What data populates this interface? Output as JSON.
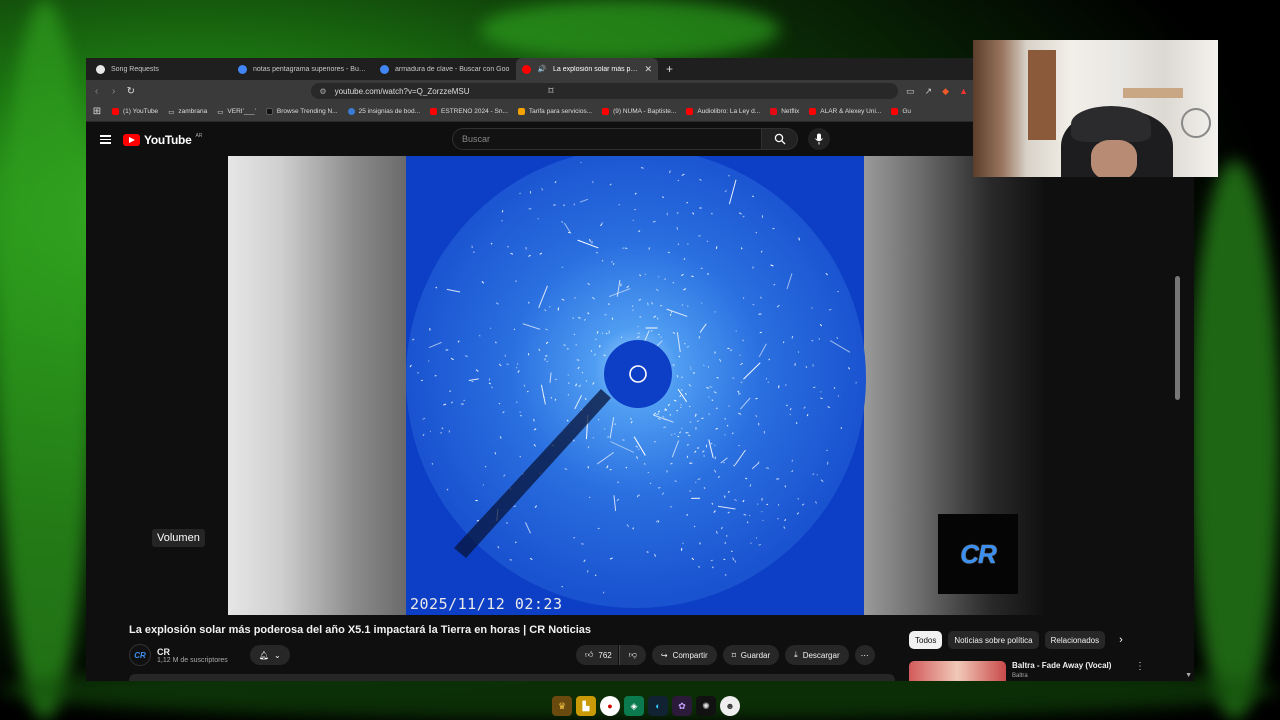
{
  "tabs": [
    {
      "label": "Song Requests",
      "fav_color": "#e7e7e7",
      "active": false
    },
    {
      "label": "notas pentagrama superiores - Busca",
      "fav_color": "#4285f4",
      "active": false
    },
    {
      "label": "armadura de clave - Buscar con Goo",
      "fav_color": "#4285f4",
      "active": false
    },
    {
      "label": "La explosión solar más podero",
      "fav_color": "#ff0000",
      "active": true
    }
  ],
  "new_tab_symbol": "+",
  "address": {
    "url": "youtube.com/watch?v=Q_ZorzzeMSU"
  },
  "bookmarks": [
    {
      "label": "(1) YouTube",
      "color": "#ff0000"
    },
    {
      "label": "zambrana",
      "color": "#888888"
    },
    {
      "label": "VERI'___'",
      "color": "#888888"
    },
    {
      "label": "Browse Trending N...",
      "color": "#222222"
    },
    {
      "label": "25 insignias de bod...",
      "color": "#3a7bd5"
    },
    {
      "label": "ESTRENO 2024 - Sn...",
      "color": "#ff0000"
    },
    {
      "label": "Tarifa para servicios...",
      "color": "#f4a300"
    },
    {
      "label": "(9) NUMA - Baptiste...",
      "color": "#ff0000"
    },
    {
      "label": "Audiolibro: La Ley d...",
      "color": "#ff0000"
    },
    {
      "label": "Netflix",
      "color": "#e50914"
    },
    {
      "label": "ALAR & Alexey Uni...",
      "color": "#ff0000"
    },
    {
      "label": "Gu",
      "color": "#ff0000"
    }
  ],
  "youtube": {
    "logo_text": "YouTube",
    "country": "AR",
    "search_placeholder": "Buscar"
  },
  "video": {
    "timestamp": "2025/11/12 02:23",
    "overlay_logo": "CR",
    "volume_tooltip": "Volumen",
    "title": "La explosión solar más poderosa del año X5.1 impactará la Tierra en horas | CR Noticias"
  },
  "channel": {
    "avatar_text": "CR",
    "name": "CR",
    "subscribers": "1,12 M de suscriptores"
  },
  "actions": {
    "likes": "762",
    "share": "Compartir",
    "save": "Guardar",
    "download": "Descargar"
  },
  "chips": [
    "Todos",
    "Noticias sobre política",
    "Relacionados"
  ],
  "related": {
    "title": "Baltra - Fade Away (Vocal)",
    "channel": "Baltra"
  },
  "colors": {
    "accent_red": "#ff0000",
    "coronagraph_blue": "#0d3fc6",
    "logo_blue": "#3a8ff0"
  }
}
